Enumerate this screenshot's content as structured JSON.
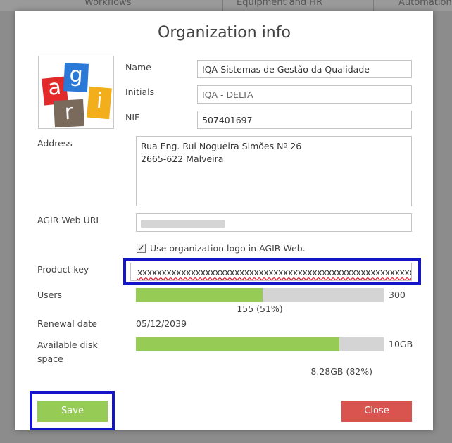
{
  "background_tabs": [
    "Workflows",
    "Equipment and HR",
    "Automation"
  ],
  "dialog": {
    "title": "Organization info",
    "fields": {
      "name": {
        "label": "Name",
        "value": "IQA-Sistemas de Gestão da Qualidade"
      },
      "initials": {
        "label": "Initials",
        "value": "IQA - DELTA"
      },
      "nif": {
        "label": "NIF",
        "value": "507401697"
      },
      "address": {
        "label": "Address",
        "value": "Rua Eng. Rui Nogueira Simões Nº 26\n2665-622 Malveira"
      },
      "web_url": {
        "label": "AGIR Web URL"
      },
      "product_key": {
        "label": "Product key",
        "value": "xxxxxxxxxxxxxxxxxxxxxxxxxxxxxxxxxxxxxxxxxxxxxxxxxxxxxxxxx"
      }
    },
    "use_logo": {
      "label": "Use organization logo in AGIR Web.",
      "checked": true
    },
    "logo": {
      "letters": [
        "a",
        "g",
        "r",
        "i"
      ]
    },
    "users": {
      "label": "Users",
      "max": "300",
      "used_text": "155 (51%)",
      "fraction": 0.51
    },
    "renewal": {
      "label": "Renewal date",
      "value": "05/12/2039"
    },
    "disk": {
      "label": "Available disk\nspace",
      "max": "10GB",
      "used_text": "8.28GB (82%)",
      "fraction": 0.82
    },
    "buttons": {
      "save": "Save",
      "close": "Close"
    }
  },
  "colors": {
    "accent_green": "#96cc55",
    "close_red": "#d9534f",
    "highlight_blue": "#1414c8",
    "logo_red": "#e32a2a",
    "logo_blue": "#2a79d6",
    "logo_brown": "#7a6a5c",
    "logo_yellow": "#f3ae1b"
  }
}
